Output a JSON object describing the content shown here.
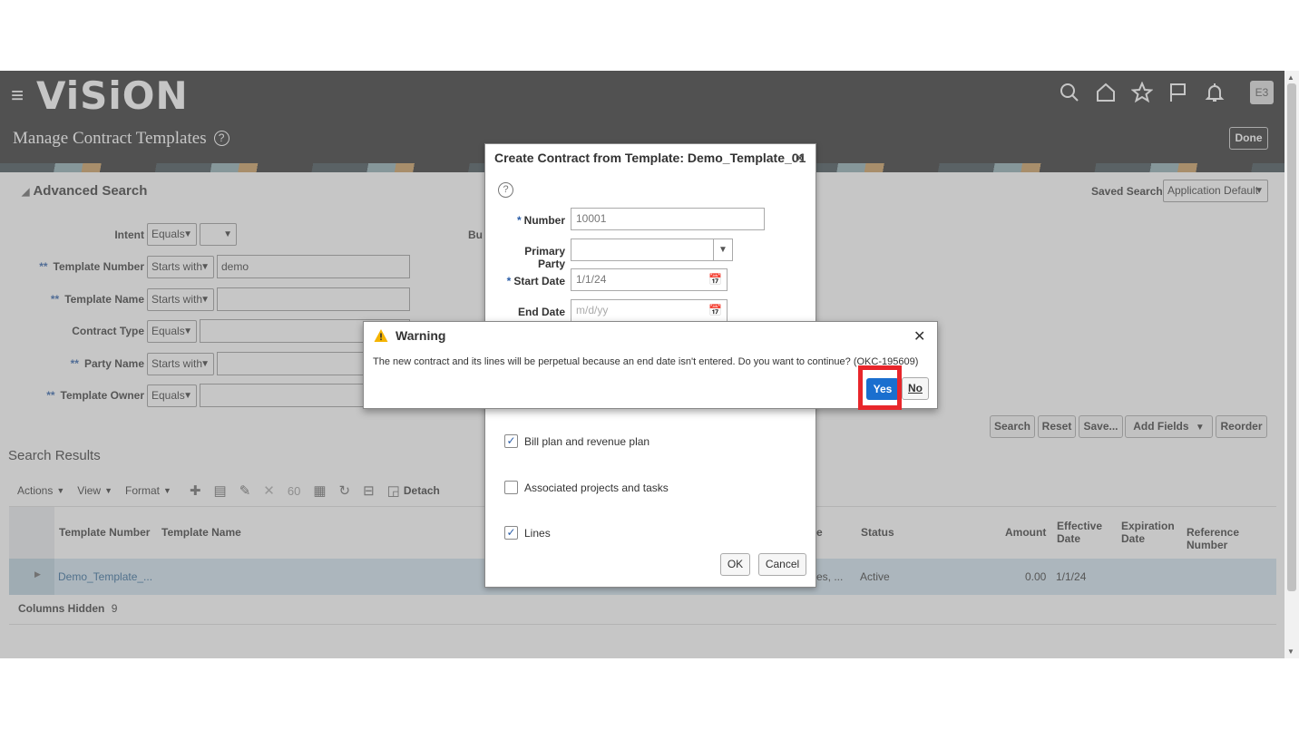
{
  "app": {
    "logo": "ViSiON",
    "page_title": "Manage Contract Templates",
    "help_glyph": "?",
    "avatar_initials": "E3",
    "done_label": "Done",
    "icons": [
      "hamburger-icon",
      "search-icon",
      "home-icon",
      "star-icon",
      "flag-icon",
      "bell-icon"
    ]
  },
  "advanced_search": {
    "title": "Advanced Search",
    "saved_search_label": "Saved Search",
    "saved_search_value": "Application Default",
    "business_unit_fragment": "Bu",
    "fields": [
      {
        "label": "Intent",
        "required": "",
        "operator": "Equals",
        "value": ""
      },
      {
        "label": "Template Number",
        "required": "**",
        "operator": "Starts with",
        "value": "demo"
      },
      {
        "label": "Template Name",
        "required": "**",
        "operator": "Starts with",
        "value": ""
      },
      {
        "label": "Contract Type",
        "required": "",
        "operator": "Equals",
        "value": ""
      },
      {
        "label": "Party Name",
        "required": "**",
        "operator": "Starts with",
        "value": ""
      },
      {
        "label": "Template Owner",
        "required": "**",
        "operator": "Equals",
        "value": ""
      }
    ],
    "buttons": {
      "search": "Search",
      "reset": "Reset",
      "save": "Save...",
      "add_fields": "Add Fields",
      "reorder": "Reorder"
    }
  },
  "results": {
    "title": "Search Results",
    "toolbar": {
      "actions": "Actions",
      "view": "View",
      "format": "Format",
      "detach": "Detach"
    },
    "columns": [
      "Template Number",
      "Template Name",
      "e",
      "Status",
      "Amount",
      "Effective Date",
      "Expiration Date",
      "Reference Number"
    ],
    "rows": [
      {
        "template_number": "Demo_Template_...",
        "col_fragment": "es, ...",
        "status": "Active",
        "amount": "0.00",
        "effective_date": "1/1/24"
      }
    ],
    "columns_hidden_label": "Columns Hidden",
    "columns_hidden_count": "9"
  },
  "create_dialog": {
    "title": "Create Contract from Template: Demo_Template_01",
    "number_label": "Number",
    "number_value": "10001",
    "primary_party_label": "Primary Party",
    "start_date_label": "Start Date",
    "start_date_value": "1/1/24",
    "end_date_label": "End Date",
    "end_date_placeholder": "m/d/yy",
    "checkboxes": [
      {
        "label": "Bill plan and revenue plan",
        "checked": true
      },
      {
        "label": "Associated projects and tasks",
        "checked": false
      },
      {
        "label": "Lines",
        "checked": true
      }
    ],
    "ok_label": "OK",
    "cancel_label": "Cancel"
  },
  "warning": {
    "title": "Warning",
    "message": "The new contract and its lines will be perpetual because an end date isn't entered. Do you want to continue? (OKC-195609)",
    "yes_label": "Yes",
    "no_label": "No",
    "highlight_color": "#e8262b"
  }
}
